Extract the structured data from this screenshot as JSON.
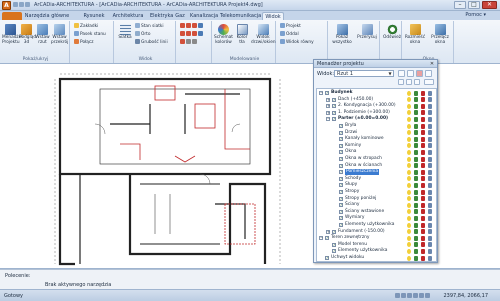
{
  "window": {
    "title": "ArCADia-ARCHITEKTURA - [ArCADia-ARCHITEKTURA - ArCADia-ARCHITEKTURA Projekt4.dwg]",
    "minimize": "–",
    "maximize": "□",
    "close": "✕"
  },
  "tabs": [
    {
      "label": "",
      "kind": "file"
    },
    {
      "label": "Narzędzia główne"
    },
    {
      "label": "Rysunek"
    },
    {
      "label": "Architektura"
    },
    {
      "label": "Elektryka"
    },
    {
      "label": "Gaz"
    },
    {
      "label": "Kanalizacja"
    },
    {
      "label": "Telekomunikacja"
    },
    {
      "label": "Widok",
      "active": true
    }
  ],
  "help": "Pomoc ▾",
  "ribbon": {
    "groups": [
      {
        "label": "Pokaż/ukryj"
      },
      {
        "label": ""
      },
      {
        "label": "Widok"
      },
      {
        "label": "Modelowanie"
      },
      {
        "label": ""
      },
      {
        "label": "Okno"
      }
    ],
    "buttons": {
      "manager": "Menadżer Projektu",
      "view3d": "Podgląd 3d",
      "insert_view": "Wstaw rzut",
      "insert_view2": "Wstaw przekrój",
      "siatka": "Siatka",
      "scheme": "Schemat kolorów",
      "color_bar": "Kolor tła",
      "window_visibility": "Widok drzwi/okien",
      "show_window": "Pokaż wszystko",
      "refresh": "Przerysuj",
      "regen": "Odśwież",
      "windows": "Rozmieść okna",
      "okno": "Przełącz okna"
    },
    "small": {
      "s1": "Zakładki",
      "s2": "Pasek stanu",
      "s3": "Połącz",
      "s4": "Stan siatki",
      "s5": "Orto",
      "s6": "Grubość linii",
      "s7": "Projekt",
      "s8": "Oddal",
      "s9": "Widok równy"
    }
  },
  "project_manager": {
    "title": "Menadżer projektu",
    "view_label": "Widok:",
    "view_value": "Rzut 1",
    "tree": [
      {
        "label": "Budynek",
        "level": 0,
        "expand": "−",
        "bold": true
      },
      {
        "label": "Dach (+450.00)",
        "level": 1,
        "expand": "+"
      },
      {
        "label": "2. Kondygnacja (+300.00)",
        "level": 1,
        "expand": "+"
      },
      {
        "label": "1. Podziemie (+300.00)",
        "level": 1,
        "expand": "+"
      },
      {
        "label": "Parter (±0.00=0.00)",
        "level": 1,
        "expand": "−",
        "bold": true
      },
      {
        "label": "Bryła",
        "level": 2
      },
      {
        "label": "Drzwi",
        "level": 2
      },
      {
        "label": "Kanały kominowe",
        "level": 2
      },
      {
        "label": "Kominy",
        "level": 2
      },
      {
        "label": "Okna",
        "level": 2
      },
      {
        "label": "Okna w stropach",
        "level": 2
      },
      {
        "label": "Okna w ścianach",
        "level": 2
      },
      {
        "label": "Pomieszczenia",
        "level": 2,
        "highlight": true
      },
      {
        "label": "Schody",
        "level": 2
      },
      {
        "label": "Słupy",
        "level": 2
      },
      {
        "label": "Stropy",
        "level": 2
      },
      {
        "label": "Stropy poniżej",
        "level": 2
      },
      {
        "label": "Ściany",
        "level": 2
      },
      {
        "label": "Ściany wstawione",
        "level": 2
      },
      {
        "label": "Wymiary",
        "level": 2
      },
      {
        "label": "Elementy użytkownika",
        "level": 2
      },
      {
        "label": "Fundament (-150.00)",
        "level": 1,
        "expand": "+"
      },
      {
        "label": "Teren zewnętrzny",
        "level": 0,
        "expand": "−"
      },
      {
        "label": "Model terenu",
        "level": 1
      },
      {
        "label": "Elementy użytkownika",
        "level": 1
      },
      {
        "label": "Uchwyt widoku",
        "level": 0
      }
    ]
  },
  "command": {
    "label": "Polecenie:",
    "status": "Brak aktywnego narzędzia"
  },
  "status": {
    "left": "Gotowy",
    "coords": "2397,84, 2066,17"
  },
  "colors": {
    "accent": "#d9731c",
    "wall_red": "#c0282a",
    "highlight": "#3b7bd0"
  }
}
